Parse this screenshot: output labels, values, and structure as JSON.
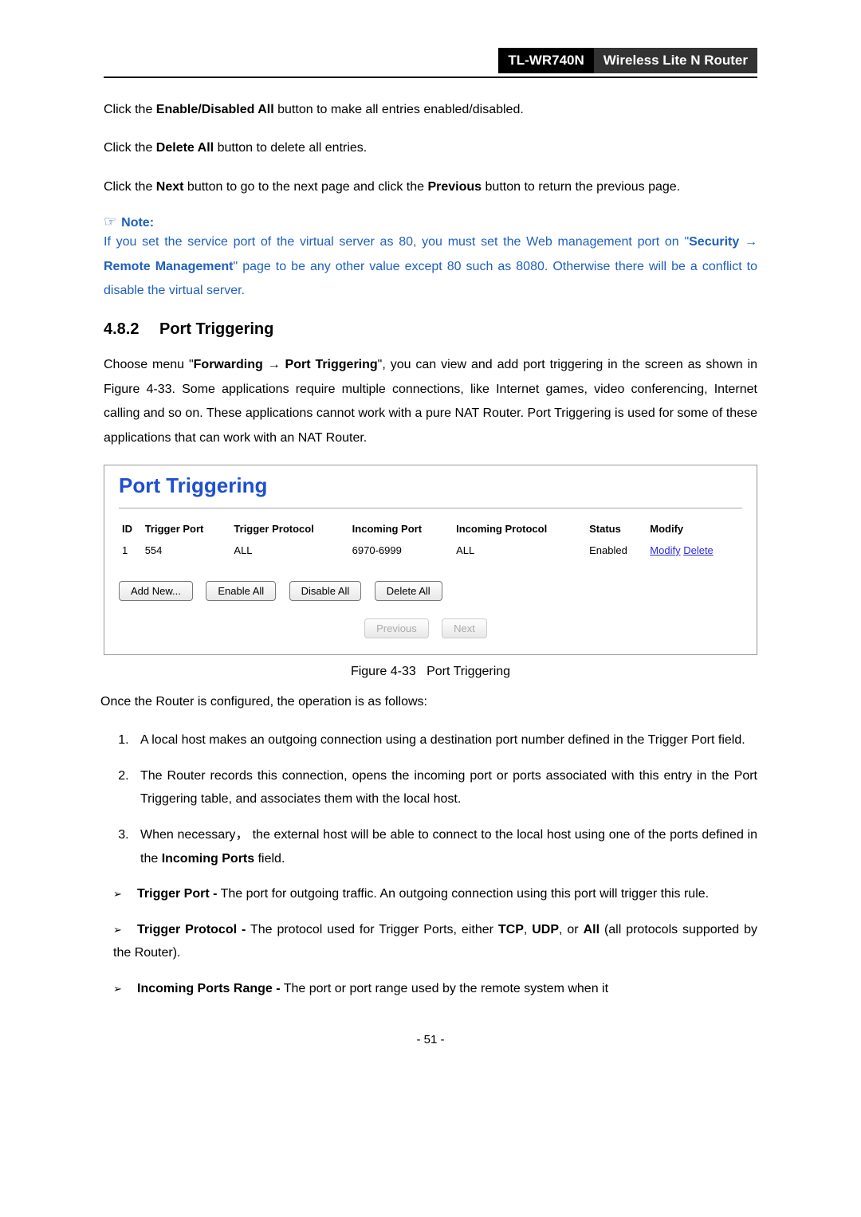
{
  "header": {
    "model": "TL-WR740N",
    "product": "Wireless Lite N Router"
  },
  "para1_pre": "Click the ",
  "para1_bold": "Enable/Disabled All",
  "para1_post": " button to make all entries enabled/disabled.",
  "para2_pre": "Click the ",
  "para2_bold": "Delete All",
  "para2_post": " button to delete all entries.",
  "para3_pre": "Click the ",
  "para3_b1": "Next",
  "para3_mid": " button to go to the next page and click the ",
  "para3_b2": "Previous",
  "para3_post": " button to return the previous page.",
  "note_label": "Note:",
  "note_text_1": "If you set the service port of the virtual server as 80, you must set the Web management port on \"",
  "note_b1": "Security",
  "note_arrow": " → ",
  "note_b2": "Remote Management",
  "note_text_2": "\" page to be any other value except 80 such as 8080. Otherwise there will be a conflict to disable the virtual server.",
  "section_num": "4.8.2",
  "section_title": "Port Triggering",
  "desc_pre": "Choose menu \"",
  "desc_b1": "Forwarding",
  "desc_arrow": " → ",
  "desc_b2": "Port Triggering",
  "desc_post": "\", you can view and add port triggering in the screen as shown in Figure 4-33. Some applications require multiple connections, like Internet games, video conferencing, Internet calling and so on. These applications cannot work with a pure NAT Router. Port Triggering is used for some of these applications that can work with an NAT Router.",
  "screenshot": {
    "title": "Port Triggering",
    "headers": {
      "id": "ID",
      "trigger_port": "Trigger Port",
      "trigger_protocol": "Trigger Protocol",
      "incoming_port": "Incoming Port",
      "incoming_protocol": "Incoming Protocol",
      "status": "Status",
      "modify": "Modify"
    },
    "rows": [
      {
        "id": "1",
        "trigger_port": "554",
        "trigger_protocol": "ALL",
        "incoming_port": "6970-6999",
        "incoming_protocol": "ALL",
        "status": "Enabled",
        "modify": "Modify",
        "delete": "Delete"
      }
    ],
    "buttons": {
      "add_new": "Add New...",
      "enable_all": "Enable All",
      "disable_all": "Disable All",
      "delete_all": "Delete All",
      "previous": "Previous",
      "next": "Next"
    }
  },
  "figure_caption_pre": "Figure 4-33",
  "figure_caption_post": "Port Triggering",
  "once_text": "Once the Router is configured, the operation is as follows:",
  "steps": [
    "A local host makes an outgoing connection using a destination port number defined in the Trigger Port field.",
    "The Router records this connection, opens the incoming port or ports associated with this entry in the Port Triggering table, and associates them with the local host.",
    "When necessary， the external host will be able to connect to the local host using one of the ports defined in the <b>Incoming Ports</b> field."
  ],
  "bullets": [
    "<b>Trigger Port -</b> The port for outgoing traffic. An outgoing connection using this port will trigger this rule.",
    "<b>Trigger Protocol -</b> The protocol used for Trigger Ports, either <b>TCP</b>, <b>UDP</b>, or <b>All</b> (all protocols supported by the Router).",
    "<b>Incoming Ports Range -</b> The port or port range used by the remote system when it"
  ],
  "page_num": "- 51 -"
}
